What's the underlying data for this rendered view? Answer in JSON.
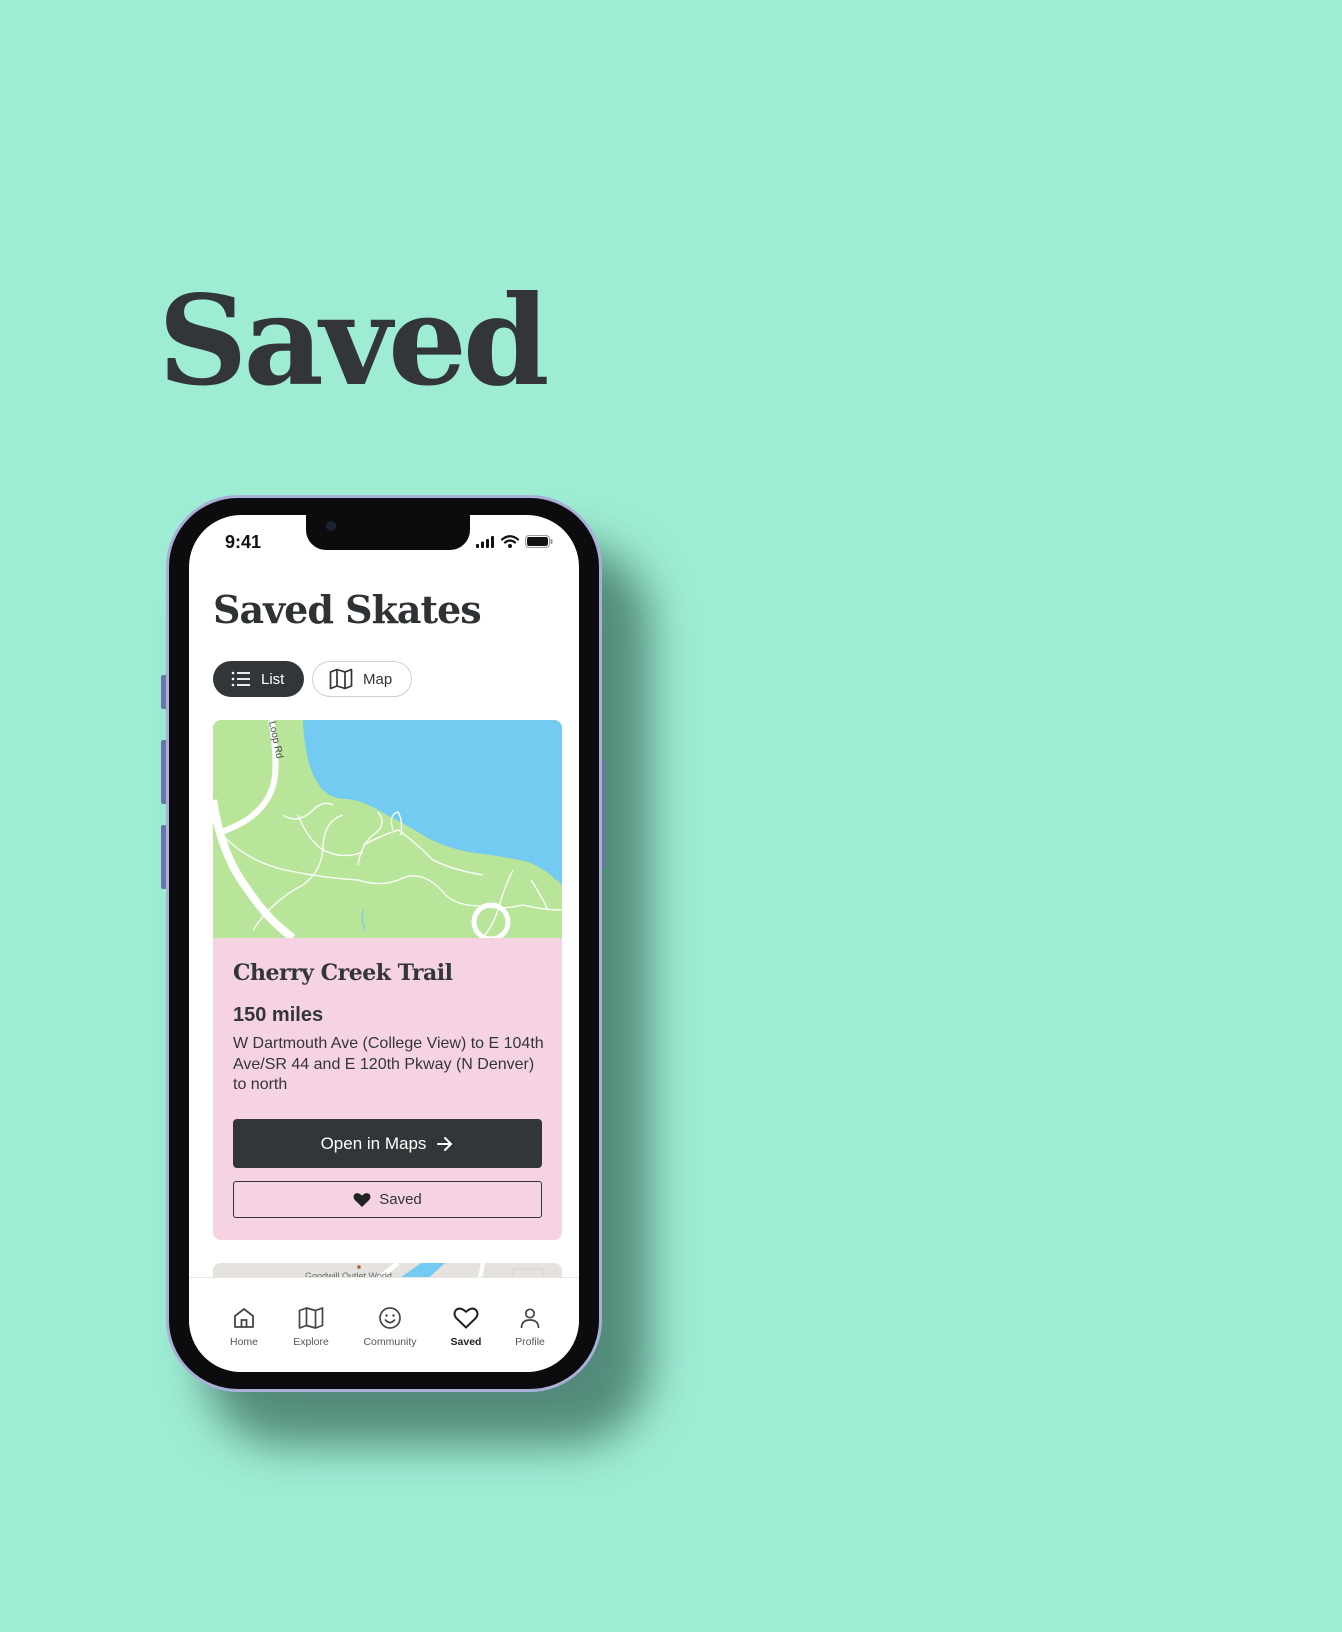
{
  "hero": {
    "title": "Saved"
  },
  "status_bar": {
    "time": "9:41"
  },
  "screen": {
    "title": "Saved Skates"
  },
  "view_toggle": {
    "list_label": "List",
    "map_label": "Map",
    "active": "List"
  },
  "card": {
    "map_road_label": "Loop Rd",
    "title": "Cherry Creek Trail",
    "distance": "150 miles",
    "description": "W Dartmouth Ave (College View) to E 104th Ave/SR 44 and E 120th Pkway (N Denver) to north",
    "open_button": "Open in Maps",
    "saved_button": "Saved"
  },
  "next_card": {
    "map_label": "Goodwill Outlet World"
  },
  "tabbar": {
    "items": [
      {
        "label": "Home",
        "icon": "home-icon"
      },
      {
        "label": "Explore",
        "icon": "map-icon"
      },
      {
        "label": "Community",
        "icon": "smiley-icon"
      },
      {
        "label": "Saved",
        "icon": "heart-icon"
      },
      {
        "label": "Profile",
        "icon": "person-icon"
      }
    ],
    "active": "Saved"
  },
  "colors": {
    "background": "#9eecd4",
    "dark": "#333638",
    "card": "#f6d3e3",
    "map_land": "#b9e59a",
    "map_water": "#74cbf1"
  }
}
